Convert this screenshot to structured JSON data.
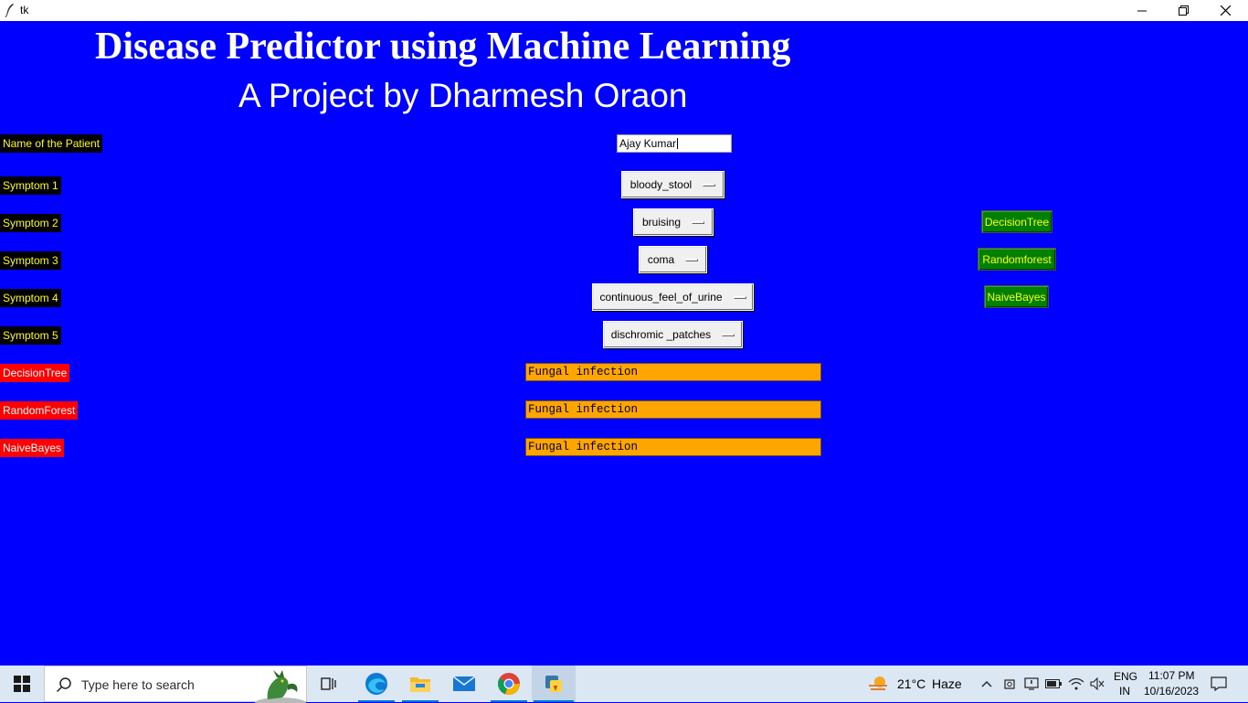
{
  "window": {
    "title": "tk",
    "buttons": {
      "minimize": "minimize-icon",
      "restore": "restore-icon",
      "close": "close-icon"
    }
  },
  "header": {
    "title": "Disease Predictor using Machine Learning",
    "subtitle": "A Project by  Dharmesh Oraon"
  },
  "form": {
    "patient_label": "Name of the Patient",
    "patient_name": "Ajay Kumar",
    "symptoms": [
      {
        "label": "Symptom 1",
        "value": "bloody_stool"
      },
      {
        "label": "Symptom 2",
        "value": "bruising"
      },
      {
        "label": "Symptom 3",
        "value": "coma"
      },
      {
        "label": "Symptom 4",
        "value": "continuous_feel_of_urine"
      },
      {
        "label": "Symptom 5",
        "value": "dischromic _patches"
      }
    ]
  },
  "results": [
    {
      "label": "DecisionTree",
      "value": "Fungal infection"
    },
    {
      "label": "RandomForest",
      "value": "Fungal infection"
    },
    {
      "label": "NaiveBayes",
      "value": "Fungal infection"
    }
  ],
  "buttons": {
    "decision_tree": "DecisionTree",
    "random_forest": "Randomforest",
    "naive_bayes": "NaiveBayes"
  },
  "colors": {
    "background": "#0000ff",
    "label_bg": "#000000",
    "label_text": "#ffff00",
    "result_label_bg": "#ff0000",
    "result_bg": "#ffa500",
    "button_bg": "#008000"
  },
  "taskbar": {
    "search_placeholder": "Type here to search",
    "weather_temp": "21°C",
    "weather_desc": "Haze",
    "language": "ENG",
    "region": "IN",
    "time": "11:07 PM",
    "date": "10/16/2023",
    "icons": [
      "windows-start-icon",
      "search-icon",
      "task-view-icon",
      "edge-icon",
      "file-explorer-icon",
      "mail-icon",
      "chrome-icon",
      "python-icon"
    ]
  }
}
